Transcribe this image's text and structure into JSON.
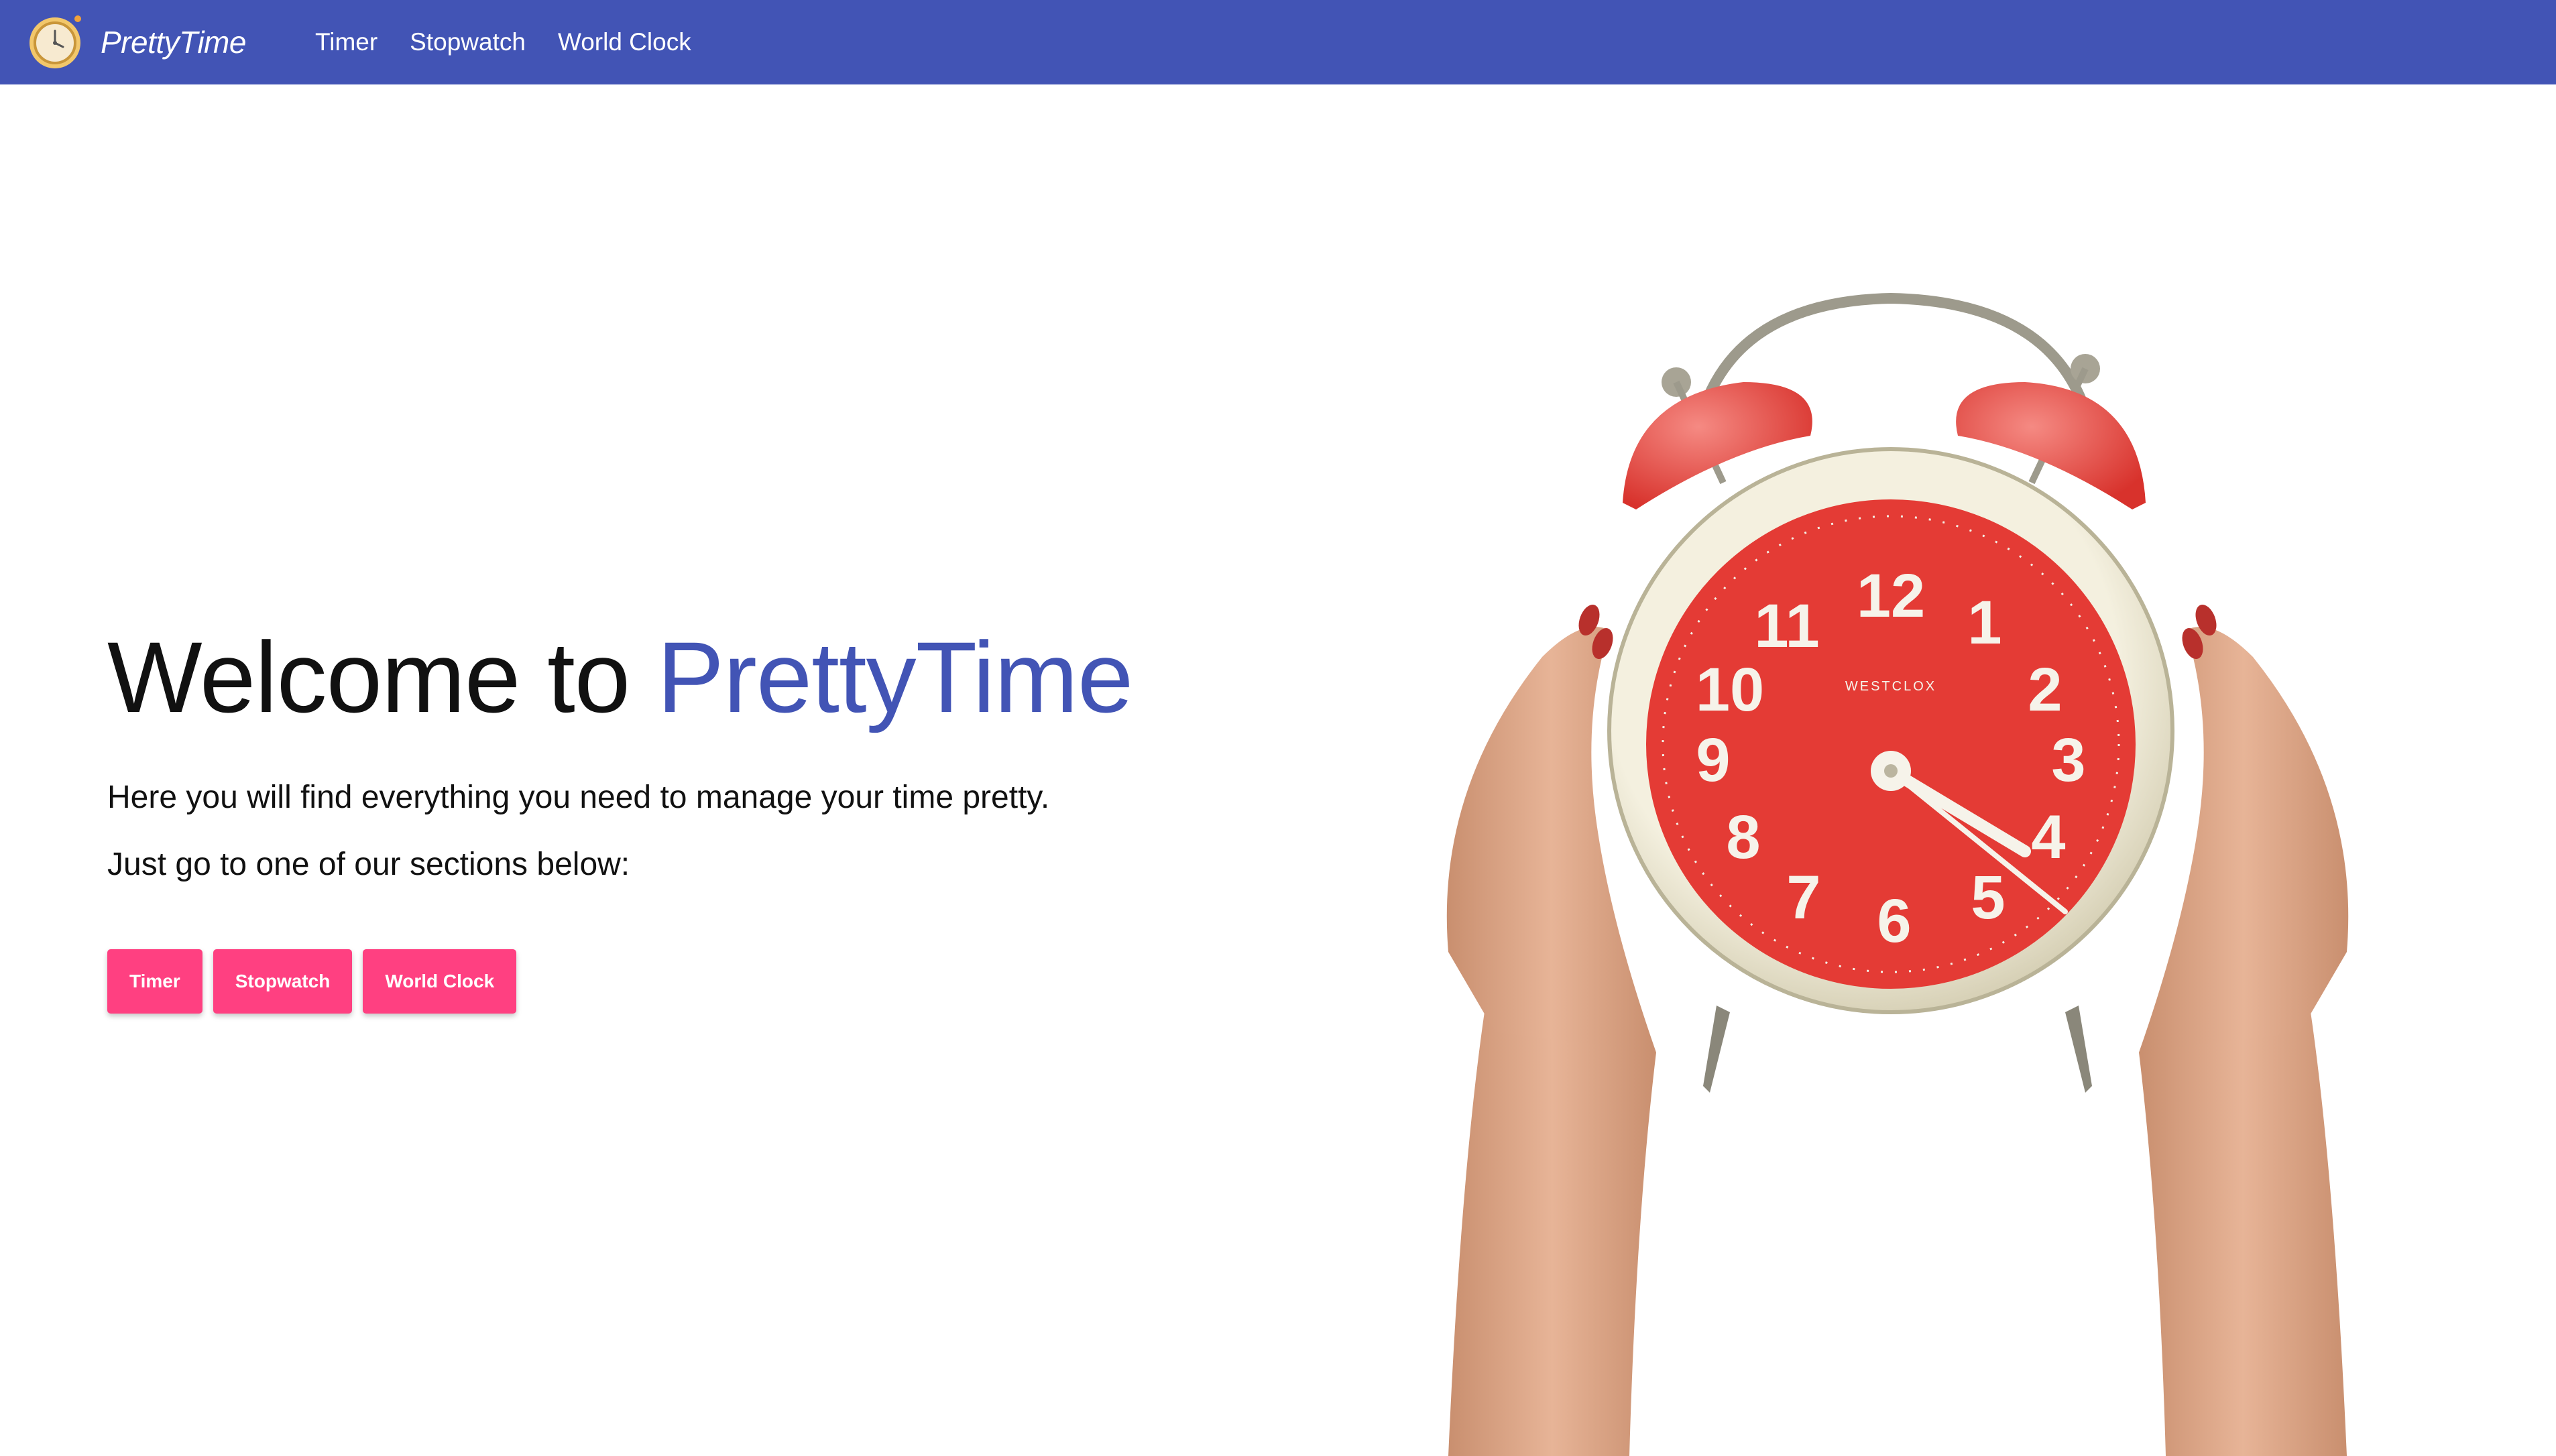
{
  "app": {
    "brand_name": "PrettyTime",
    "brand_logo_icon": "alarm-clock-logo-icon",
    "accent_color": "#4254b5",
    "button_color": "#ff4081"
  },
  "nav": {
    "items": [
      {
        "label": "Timer"
      },
      {
        "label": "Stopwatch"
      },
      {
        "label": "World Clock"
      }
    ]
  },
  "hero": {
    "title_prefix": "Welcome to ",
    "title_accent": "PrettyTime",
    "line1": "Here you will find everything you need to manage your time pretty.",
    "line2": "Just go to one of our sections below:",
    "buttons": [
      {
        "label": "Timer"
      },
      {
        "label": "Stopwatch"
      },
      {
        "label": "World Clock"
      }
    ]
  },
  "illustration": {
    "icon": "alarm-clock-held-by-hands-image",
    "clock_brand": "WESTCLOX",
    "dial_numbers": [
      "12",
      "1",
      "2",
      "3",
      "4",
      "5",
      "6",
      "7",
      "8",
      "9",
      "10",
      "11"
    ],
    "face_color": "#e43b35"
  }
}
